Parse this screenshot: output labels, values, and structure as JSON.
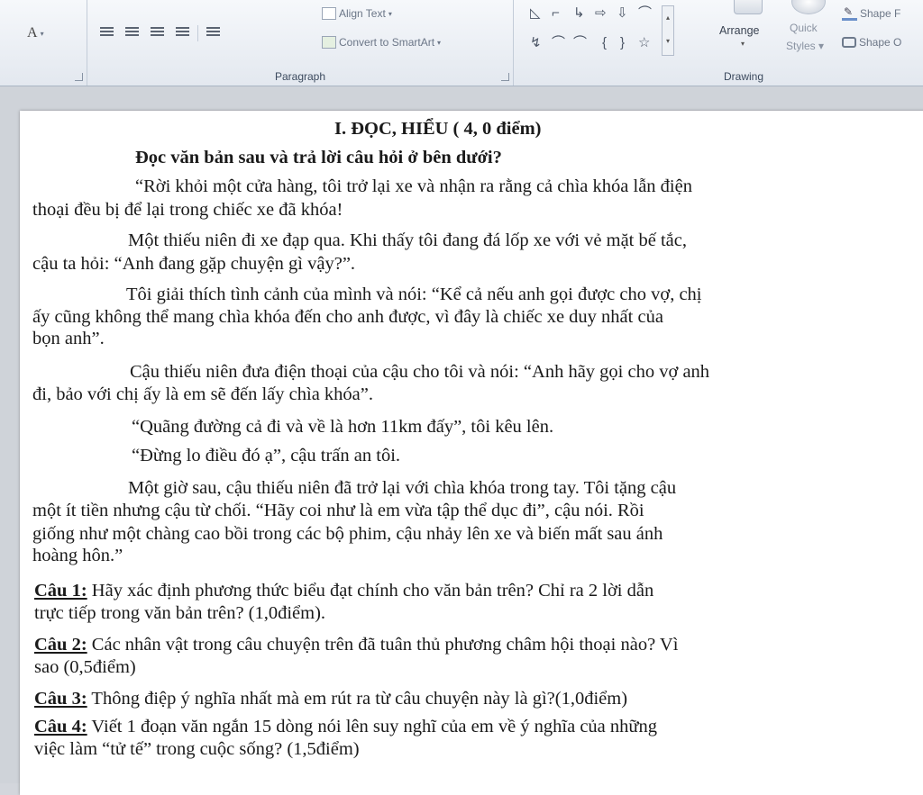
{
  "ribbon": {
    "font_color_button": "A",
    "align_text": "Align Text",
    "convert_smartart": "Convert to SmartArt",
    "paragraph_label": "Paragraph",
    "drawing_label": "Drawing",
    "arrange": "Arrange",
    "quick": "Quick",
    "styles": "Styles",
    "shape_fill": "Shape F",
    "shape_outline": "Shape O",
    "shape_glyphs_row1": [
      "◺",
      "⌐",
      "↳",
      "⇨",
      "⇩",
      "⌒"
    ],
    "shape_glyphs_row2": [
      "↯",
      "⌒",
      "⌒",
      "{",
      "}",
      "☆"
    ]
  },
  "document": {
    "heading": "I. ĐỌC, HIỂU ( 4, 0 điểm)",
    "subheading": "Đọc văn bản sau và trả lời câu hỏi ở bên dưới?",
    "lines": [
      "“Rời khỏi một cửa hàng, tôi trở lại xe và nhận ra rằng cả chìa khóa lẫn điện",
      "thoại đều bị để lại trong chiếc xe đã khóa!",
      "Một thiếu niên đi xe đạp qua. Khi thấy tôi đang đá lốp xe với vẻ mặt bế tắc,",
      "cậu ta hỏi: “Anh đang gặp chuyện gì vậy?”.",
      "Tôi giải thích tình cảnh của mình và nói: “Kể cả nếu anh gọi được cho vợ, chị",
      "ấy cũng không thể mang chìa khóa đến cho anh được, vì đây là chiếc xe duy nhất của",
      "bọn anh”.",
      "Cậu thiếu niên đưa điện thoại của cậu cho tôi và nói: “Anh hãy gọi cho vợ anh",
      "đi, bảo với chị ấy là em sẽ đến lấy chìa khóa”.",
      "“Quãng đường cả đi và về là hơn 11km đấy”, tôi kêu lên.",
      "“Đừng lo điều đó ạ”, cậu trấn an tôi.",
      "Một giờ sau, cậu thiếu niên đã trở lại với chìa khóa trong tay. Tôi tặng cậu",
      "một ít tiền nhưng cậu từ chối. “Hãy coi như là em vừa tập thể dục đi”, cậu nói. Rồi",
      "giống như một chàng cao bồi trong các bộ phim, cậu nhảy lên xe và biến mất sau ánh",
      "hoàng hôn.”"
    ],
    "questions": [
      {
        "label": "Câu 1:",
        "text": " Hãy xác định phương thức biểu đạt chính cho văn bản trên? Chỉ ra 2 lời dẫn",
        "cont": "trực tiếp trong văn bản trên? (1,0điểm)."
      },
      {
        "label": "Câu 2:",
        "text": " Các nhân vật trong câu chuyện trên đã tuân thủ phương châm hội thoại nào? Vì",
        "cont": "sao (0,5điểm)"
      },
      {
        "label": "Câu 3:",
        "text": " Thông điệp ý nghĩa nhất mà em rút ra từ câu chuyện này là gì?(1,0điểm)",
        "cont": ""
      },
      {
        "label": "Câu 4:",
        "text": " Viết 1 đoạn văn ngắn 15 dòng nói lên suy nghĩ của em về ý nghĩa của những",
        "cont": "việc làm “tử tế” trong cuộc sống? (1,5điểm)"
      }
    ]
  }
}
